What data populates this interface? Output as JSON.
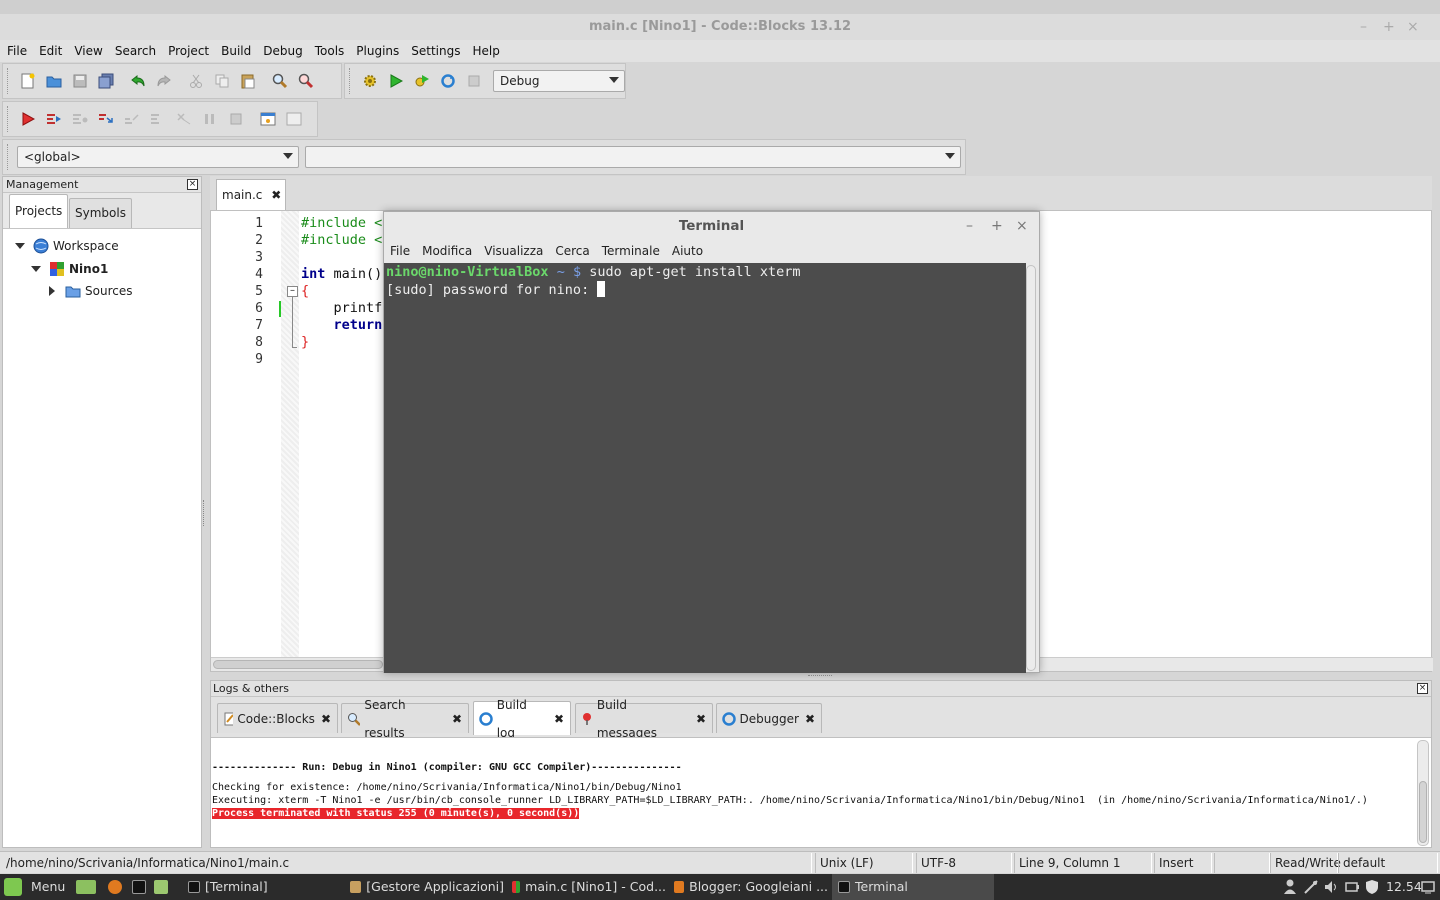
{
  "window": {
    "title": "main.c [Nino1] - Code::Blocks 13.12",
    "controls": [
      "–",
      "+",
      "×"
    ]
  },
  "menubar": [
    "File",
    "Edit",
    "View",
    "Search",
    "Project",
    "Build",
    "Debug",
    "Tools",
    "Plugins",
    "Settings",
    "Help"
  ],
  "toolbar": {
    "build_target": "Debug",
    "scope_select": "<global>",
    "symbol_select": ""
  },
  "management": {
    "title": "Management",
    "close": "×",
    "tabs": [
      "Projects",
      "Symbols"
    ],
    "tree": {
      "workspace": "Workspace",
      "project": "Nino1",
      "folder": "Sources"
    }
  },
  "editor": {
    "tab_label": "main.c",
    "tab_close": "✖",
    "line_numbers": [
      "1",
      "2",
      "3",
      "4",
      "5",
      "6",
      "7",
      "8",
      "9"
    ],
    "lines": [
      {
        "kw": "",
        "text": "#include <",
        "color": "#1a8c1a"
      },
      {
        "kw": "",
        "text": "#include <",
        "color": "#1a8c1a"
      },
      {
        "kw": "",
        "text": "",
        "color": "#111"
      },
      {
        "kw": "int",
        "text": " main()",
        "color": "#111"
      },
      {
        "kw": "",
        "text": "{",
        "color": "#d22"
      },
      {
        "kw": "",
        "text": "    printf",
        "color": "#111"
      },
      {
        "kw": "    return",
        "text": "",
        "color": "#111"
      },
      {
        "kw": "",
        "text": "}",
        "color": "#d22"
      },
      {
        "kw": "",
        "text": "",
        "color": "#111"
      }
    ]
  },
  "terminal": {
    "title": "Terminal",
    "controls": [
      "–",
      "+",
      "×"
    ],
    "menu": [
      "File",
      "Modifica",
      "Visualizza",
      "Cerca",
      "Terminale",
      "Aiuto"
    ],
    "prompt_user": "nino@nino-VirtualBox",
    "prompt_path": " ~ $",
    "command": " sudo apt-get install xterm",
    "line2": "[sudo] password for nino: "
  },
  "logs": {
    "title": "Logs & others",
    "close": "×",
    "tabs": [
      {
        "label": "Code::Blocks",
        "icon": "document-icon"
      },
      {
        "label": "Search results",
        "icon": "search-icon"
      },
      {
        "label": "Build log",
        "icon": "gear-icon"
      },
      {
        "label": "Build messages",
        "icon": "pin-icon"
      },
      {
        "label": "Debugger",
        "icon": "gear-icon"
      }
    ],
    "tab_close": "✖",
    "lines": [
      "-------------- Run: Debug in Nino1 (compiler: GNU GCC Compiler)---------------",
      "Checking for existence: /home/nino/Scrivania/Informatica/Nino1/bin/Debug/Nino1",
      "Executing: xterm -T Nino1 -e /usr/bin/cb_console_runner LD_LIBRARY_PATH=$LD_LIBRARY_PATH:. /home/nino/Scrivania/Informatica/Nino1/bin/Debug/Nino1  (in /home/nino/Scrivania/Informatica/Nino1/.)"
    ],
    "error_line": "Process terminated with status 255 (0 minute(s), 0 second(s))"
  },
  "statusbar": {
    "path": "/home/nino/Scrivania/Informatica/Nino1/main.c",
    "eol": "Unix (LF)",
    "encoding": "UTF-8",
    "position": "Line 9, Column 1",
    "mode": "Insert",
    "blank": "",
    "access": "Read/Write",
    "profile": "default"
  },
  "taskbar": {
    "menu": "Menu",
    "windows": [
      {
        "label": "[Terminal]",
        "active": false
      },
      {
        "label": "[Gestore Applicazioni]",
        "active": false
      },
      {
        "label": "main.c [Nino1] - Cod...",
        "active": false
      },
      {
        "label": "Blogger: Googleiani ...",
        "active": false
      },
      {
        "label": "Terminal",
        "active": true
      }
    ],
    "clock": "12.54"
  },
  "colors": {
    "terminal_bg": "#4c4c4c",
    "prompt_green": "#6bd86b",
    "error_red": "#e8262b",
    "keyword_blue": "#00008b"
  }
}
